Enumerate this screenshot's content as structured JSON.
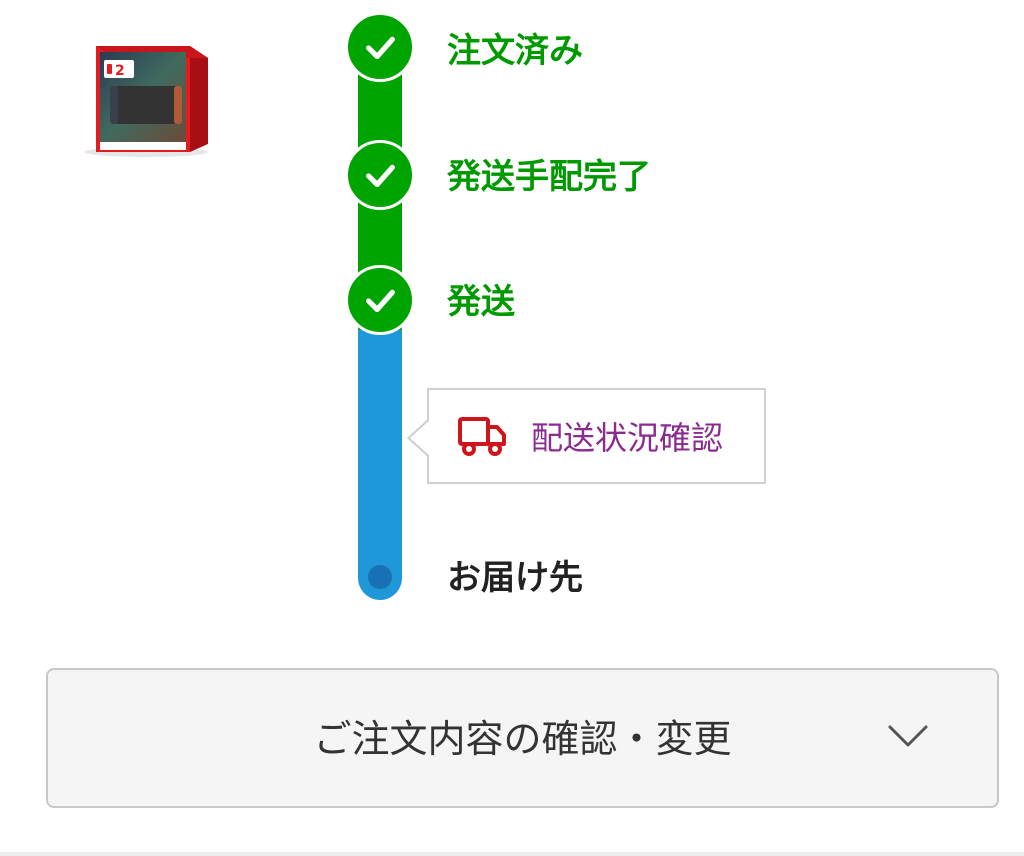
{
  "product": {
    "icon": "game-console-box-image",
    "box_text": "2"
  },
  "timeline": {
    "steps": [
      {
        "label": "注文済み",
        "status": "done"
      },
      {
        "label": "発送手配完了",
        "status": "done"
      },
      {
        "label": "発送",
        "status": "done"
      },
      {
        "label": "お届け先",
        "status": "pending"
      }
    ],
    "colors": {
      "done": "#00a400",
      "in_transit": "#1e98d8",
      "end_dot": "#1a70b4"
    }
  },
  "tracking": {
    "label": "配送状況確認",
    "icon": "delivery-truck-icon",
    "icon_color": "#d0141c",
    "label_color": "#8a2b8f"
  },
  "order_details": {
    "label": "ご注文内容の確認・変更",
    "icon": "chevron-down-icon"
  }
}
